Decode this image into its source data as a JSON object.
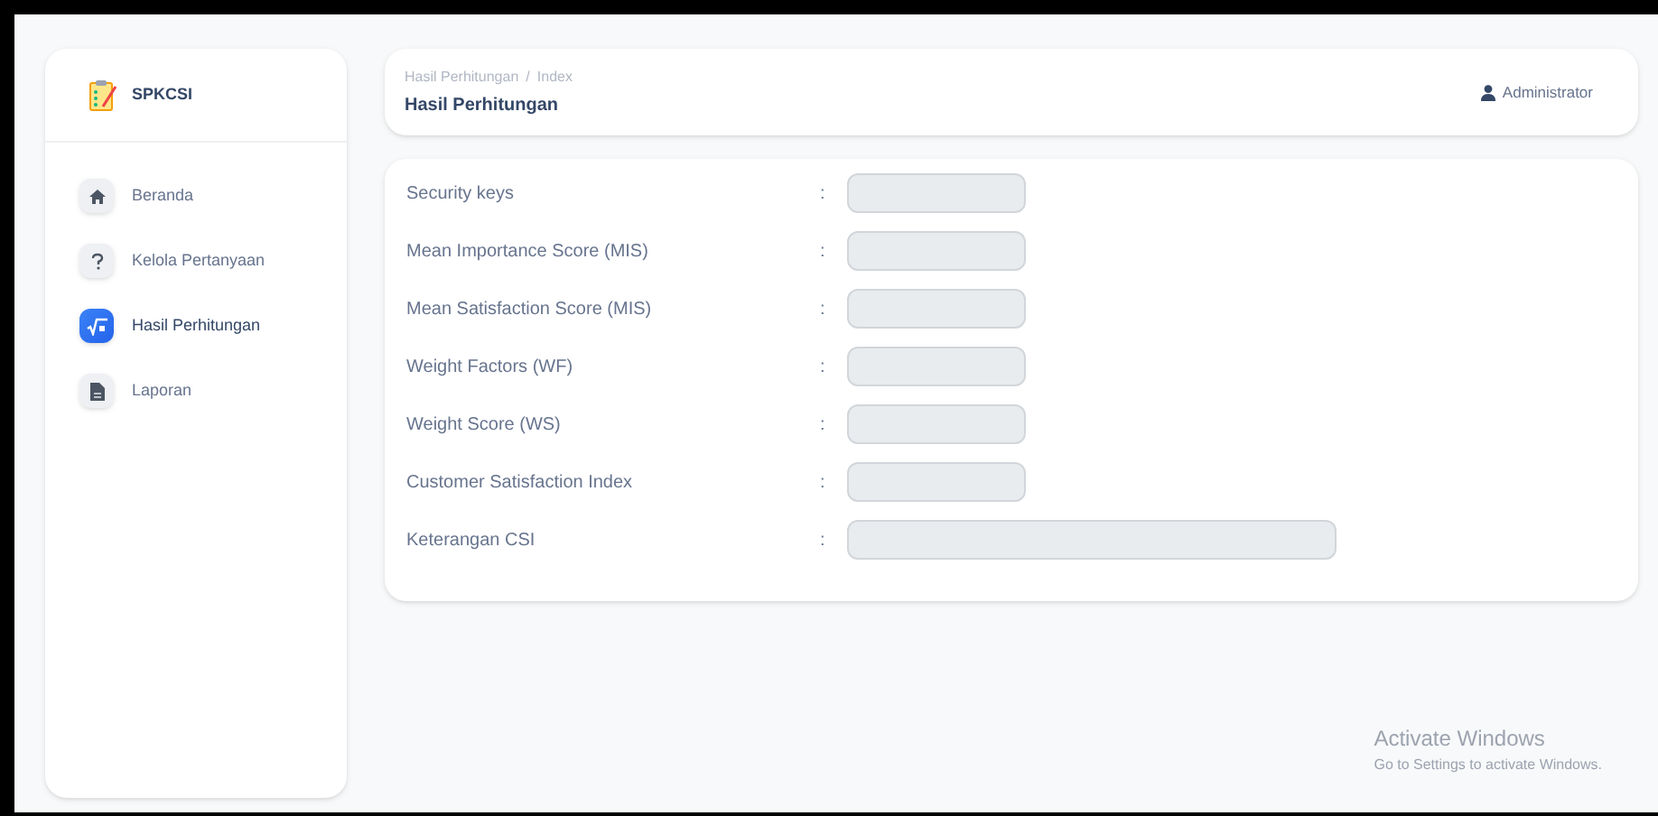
{
  "sidebar": {
    "brand": "SPKCSI",
    "items": [
      {
        "label": "Beranda",
        "kind": "home",
        "selected": false
      },
      {
        "label": "Kelola Pertanyaan",
        "kind": "question",
        "selected": false
      },
      {
        "label": "Hasil Perhitungan",
        "kind": "sqrt",
        "selected": true
      },
      {
        "label": "Laporan",
        "kind": "file",
        "selected": false
      }
    ]
  },
  "header": {
    "breadcrumb": [
      "Hasil Perhitungan",
      "Index"
    ],
    "separator": "/",
    "title": "Hasil Perhitungan",
    "user": "Administrator"
  },
  "form": {
    "colon": ":",
    "fields": [
      {
        "label": "Security keys",
        "kind": "short"
      },
      {
        "label": "Mean Importance Score (MIS)",
        "kind": "short"
      },
      {
        "label": "Mean Satisfaction Score (MIS)",
        "kind": "short"
      },
      {
        "label": "Weight Factors (WF)",
        "kind": "short"
      },
      {
        "label": "Weight Score (WS)",
        "kind": "short"
      },
      {
        "label": "Customer Satisfaction Index",
        "kind": "short"
      },
      {
        "label": "Keterangan CSI",
        "kind": "wide"
      }
    ]
  },
  "activation_notice": {
    "title": "Activate Windows",
    "text": "Go to Settings to activate Windows."
  }
}
